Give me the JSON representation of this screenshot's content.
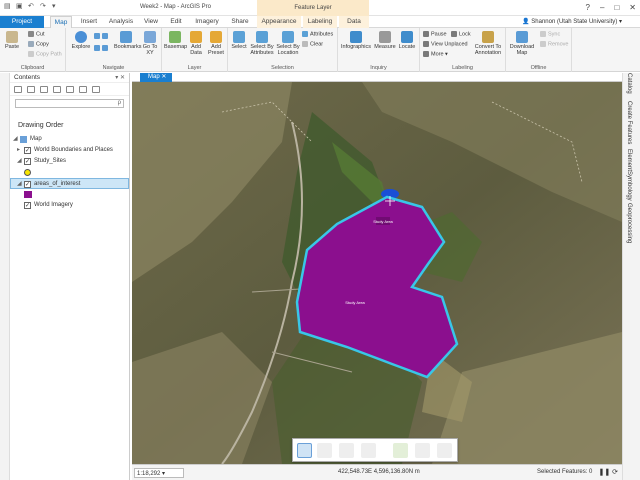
{
  "window": {
    "title": "Week2 - Map - ArcGIS Pro",
    "context_group": "Feature Layer",
    "user": "Shannon (Utah State University)"
  },
  "tabs": [
    "Project",
    "Map",
    "Insert",
    "Analysis",
    "View",
    "Edit",
    "Imagery",
    "Share",
    "Appearance",
    "Labeling",
    "Data"
  ],
  "ribbon": {
    "clipboard": {
      "paste": "Paste",
      "cut": "Cut",
      "copy": "Copy",
      "copy_path": "Copy Path",
      "label": "Clipboard"
    },
    "navigate": {
      "explore": "Explore",
      "bookmarks": "Bookmarks",
      "goto": "Go To XY",
      "label": "Navigate"
    },
    "layer": {
      "basemap": "Basemap",
      "add_data": "Add Data",
      "add_preset": "Add Preset",
      "label": "Layer"
    },
    "selection": {
      "select": "Select",
      "by_attr": "Select By Attributes",
      "by_loc": "Select By Location",
      "attributes": "Attributes",
      "clear": "Clear",
      "label": "Selection"
    },
    "inquiry": {
      "infographics": "Infographics",
      "measure": "Measure",
      "locate": "Locate",
      "label": "Inquiry"
    },
    "labeling": {
      "pause": "Pause",
      "lock": "Lock",
      "view_unplaced": "View Unplaced",
      "more": "More",
      "convert": "Convert To Annotation",
      "label": "Labeling"
    },
    "offline": {
      "download": "Download Map",
      "sync": "Sync",
      "remove": "Remove",
      "label": "Offline"
    }
  },
  "contents": {
    "title": "Contents",
    "search_hint": "ρ",
    "drawing_order": "Drawing Order",
    "items": [
      {
        "label": "Map"
      },
      {
        "label": "World Boundaries and Places"
      },
      {
        "label": "Study_Sites"
      },
      {
        "label": "areas_of_interest"
      },
      {
        "label": "World Imagery"
      }
    ]
  },
  "map_tab": "Map",
  "map_labels": [
    "Study Area",
    "Study Area"
  ],
  "status": {
    "scale": "1:18,292",
    "coords": "422,548.73E 4,596,136.80N m",
    "selected": "Selected Features: 0"
  },
  "right_tabs": [
    "Catalog",
    "Create Features",
    "Element",
    "Symbology",
    "Geoprocessing"
  ],
  "colors": {
    "accent": "#1a7fd0",
    "polygon_fill": "#8b0f8e",
    "polygon_outline": "#39c6e8",
    "study_site": "#f5e400"
  }
}
